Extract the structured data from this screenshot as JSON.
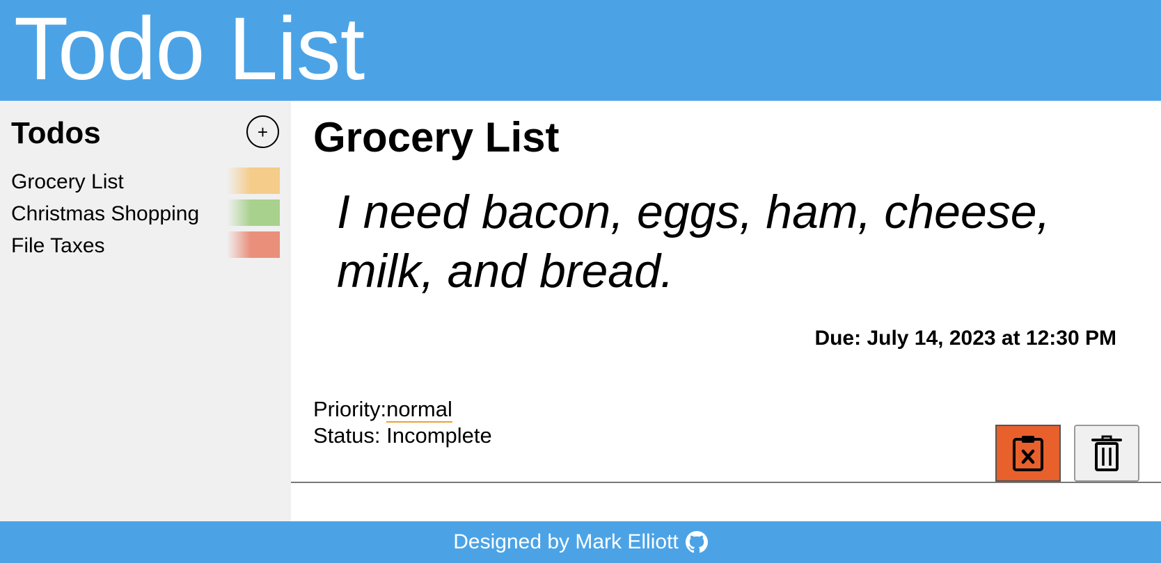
{
  "header": {
    "title": "Todo List"
  },
  "sidebar": {
    "title": "Todos",
    "add_label": "+",
    "items": [
      {
        "label": "Grocery List",
        "priority_color": "#f5cc8a"
      },
      {
        "label": "Christmas Shopping",
        "priority_color": "#a8d18d"
      },
      {
        "label": "File Taxes",
        "priority_color": "#e98f7a"
      }
    ]
  },
  "detail": {
    "title": "Grocery List",
    "description": "I need bacon, eggs, ham, cheese, milk, and bread.",
    "due": "Due: July 14, 2023 at 12:30 PM",
    "priority_label": "Priority:",
    "priority_value": "normal",
    "status": "Status: Incomplete"
  },
  "colors": {
    "header": "#4ba3e6",
    "sidebar": "#f0f0f0",
    "complete_button": "#e8602c"
  },
  "footer": {
    "text": "Designed by Mark Elliott"
  }
}
